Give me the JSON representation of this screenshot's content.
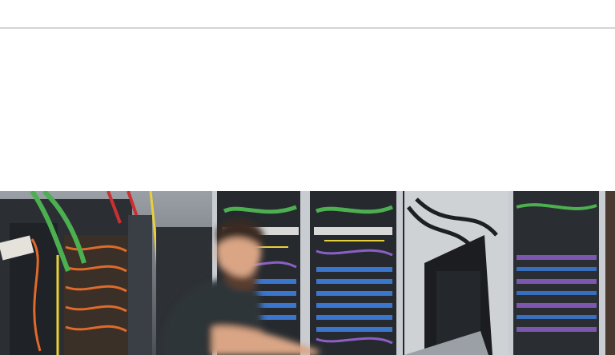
{
  "page": {
    "background": "#ffffff",
    "divider_color": "#d4d4d4"
  },
  "hero_image": {
    "subject": "server-racks-photo",
    "colors": {
      "rack_frame": "#3a3f45",
      "cable_green": "#4caf50",
      "cable_orange": "#e06a2a",
      "cable_yellow": "#e8d03a",
      "cable_purple": "#8b5fc6",
      "cable_blue": "#3d7fe0",
      "person_shirt": "#2f3438",
      "person_skin": "#d9a585"
    }
  }
}
